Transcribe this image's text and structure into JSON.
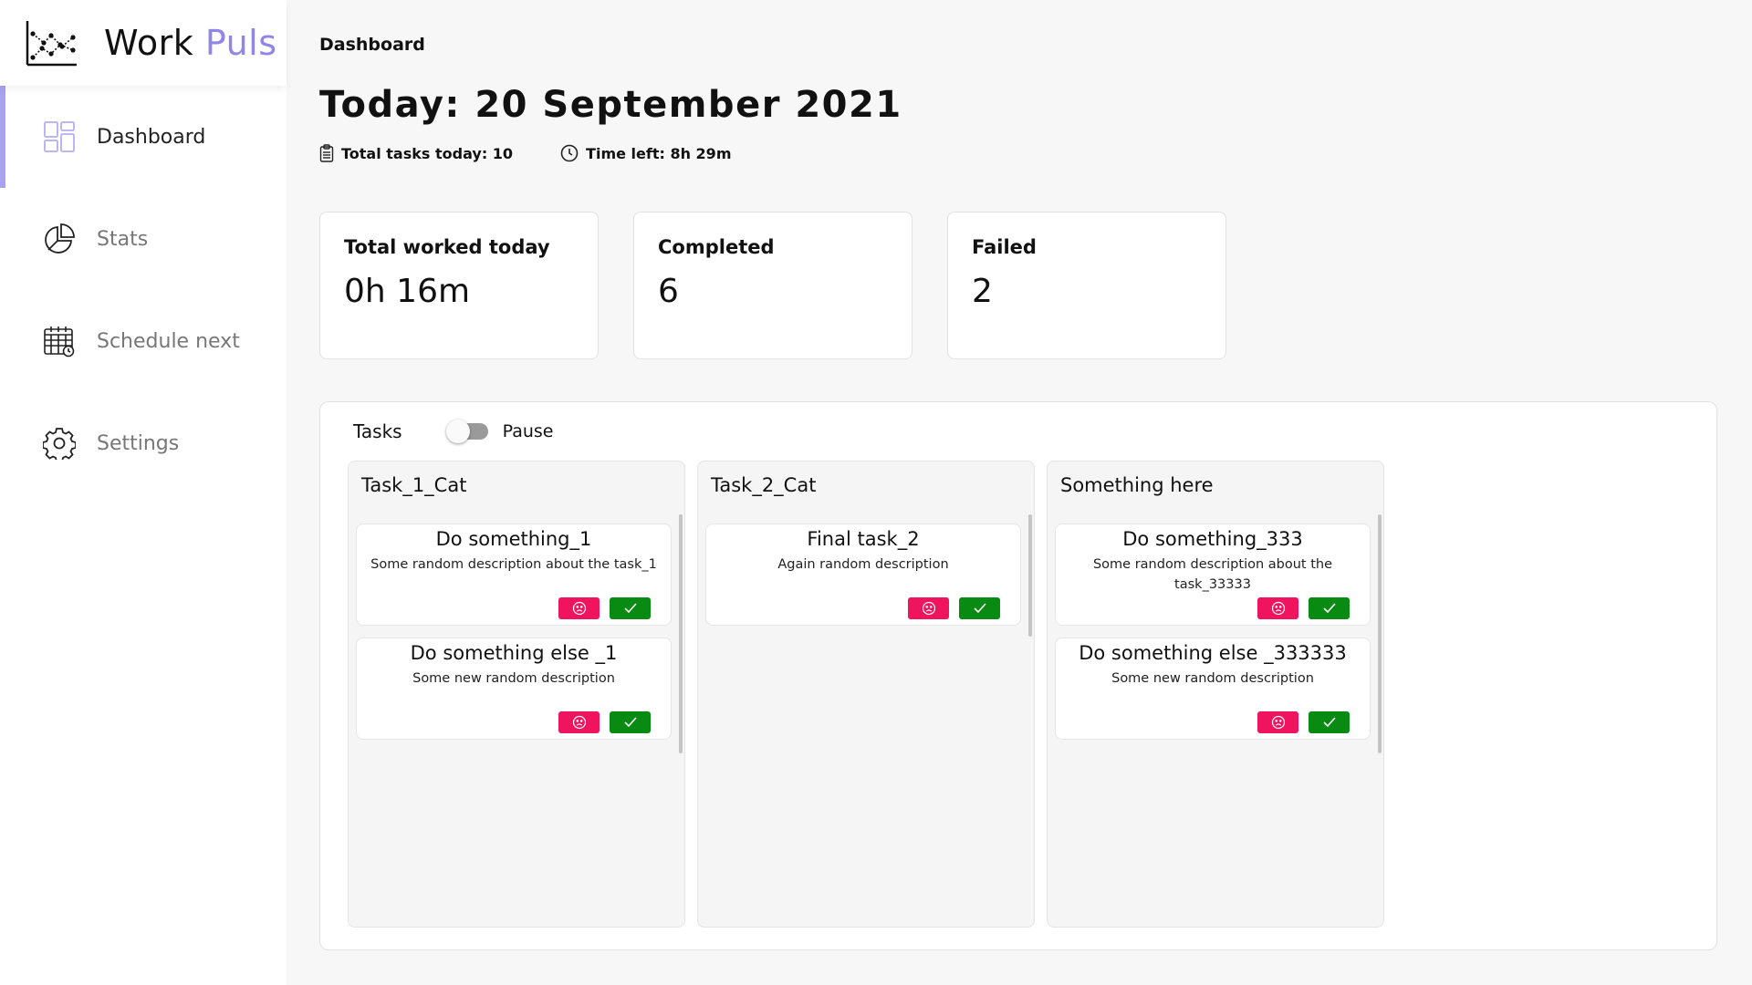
{
  "brand": {
    "name_part1": "Work",
    "name_part2": "Puls",
    "accent_color": "#8f86e8"
  },
  "nav": {
    "items": [
      {
        "label": "Dashboard",
        "icon": "layout-grid-icon",
        "active": true
      },
      {
        "label": "Stats",
        "icon": "pie-chart-icon",
        "active": false
      },
      {
        "label": "Schedule next",
        "icon": "calendar-icon",
        "active": false
      },
      {
        "label": "Settings",
        "icon": "gear-icon",
        "active": false
      }
    ]
  },
  "header": {
    "breadcrumb": "Dashboard",
    "title": "Today: 20 September 2021",
    "total_tasks": "Total tasks today: 10",
    "time_left": "Time left: 8h 29m"
  },
  "stats": [
    {
      "label": "Total worked today",
      "value": "0h 16m"
    },
    {
      "label": "Completed",
      "value": "6"
    },
    {
      "label": "Failed",
      "value": "2"
    }
  ],
  "tasks_panel": {
    "title": "Tasks",
    "toggle_label": "Pause",
    "toggle_on": false,
    "columns": [
      {
        "title": "Task_1_Cat",
        "tasks": [
          {
            "title": "Do something_1",
            "description": "Some random description about the task_1"
          },
          {
            "title": "Do something else _1",
            "description": "Some new random description"
          }
        ]
      },
      {
        "title": "Task_2_Cat",
        "tasks": [
          {
            "title": "Final task_2",
            "description": "Again random description"
          }
        ]
      },
      {
        "title": "Something here",
        "tasks": [
          {
            "title": "Do something_333",
            "description": "Some random description about the task_33333"
          },
          {
            "title": "Do something else _333333",
            "description": "Some new random description"
          }
        ]
      }
    ]
  },
  "colors": {
    "fail_button": "#f0135e",
    "done_button": "#098a12",
    "active_bar": "#a8a1f0"
  }
}
